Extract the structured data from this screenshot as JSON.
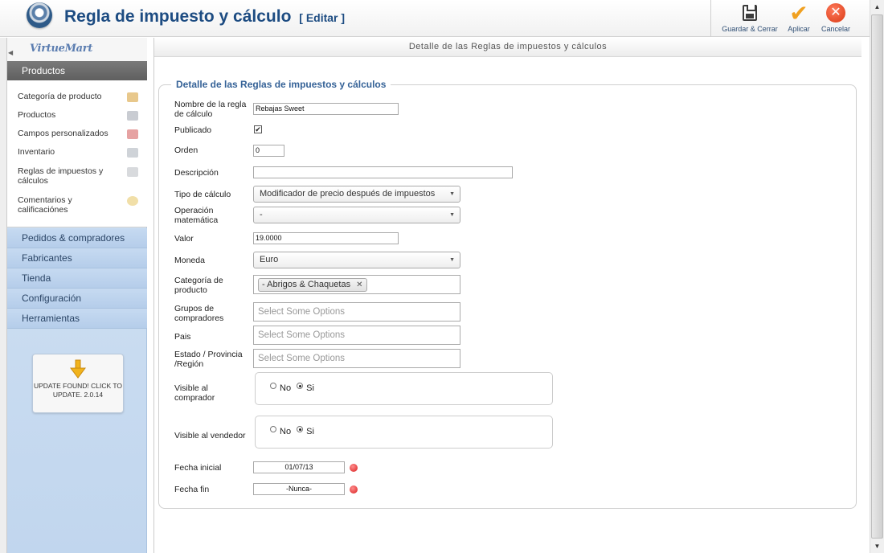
{
  "header": {
    "title": "Regla de impuesto y cálculo",
    "edit_tag": "[ Editar ]"
  },
  "toolbar": {
    "save_close": "Guardar & Cerrar",
    "apply": "Aplicar",
    "cancel": "Cancelar"
  },
  "sidebar": {
    "logo": "VirtueMart",
    "section": "Productos",
    "product_items": [
      {
        "label": "Categoría de producto",
        "icon": "category-icon"
      },
      {
        "label": "Productos",
        "icon": "products-icon"
      },
      {
        "label": "Campos personalizados",
        "icon": "custom-fields-icon"
      },
      {
        "label": "Inventario",
        "icon": "inventory-icon"
      },
      {
        "label": "Reglas de impuestos y cálculos",
        "icon": "tax-rules-icon"
      },
      {
        "label": "Comentarios y calificaciónes",
        "icon": "reviews-icon"
      }
    ],
    "nav": [
      "Pedidos & compradores",
      "Fabricantes",
      "Tienda",
      "Configuración",
      "Herramientas"
    ],
    "update_notice": "UPDATE FOUND! CLICK TO UPDATE. 2.0.14"
  },
  "main": {
    "tab_title": "Detalle de las Reglas de impuestos y cálculos",
    "legend": "Detalle de las Reglas de impuestos y cálculos",
    "fields": {
      "name_label": "Nombre de la regla de cálculo",
      "name_value": "Rebajas Sweet",
      "published_label": "Publicado",
      "published_checked": true,
      "order_label": "Orden",
      "order_value": "0",
      "description_label": "Descripción",
      "description_value": "",
      "calc_type_label": "Tipo de cálculo",
      "calc_type_value": "Modificador de precio después de impuestos",
      "math_op_label": "Operación matemática",
      "math_op_value": "-",
      "value_label": "Valor",
      "value_value": "19.0000",
      "currency_label": "Moneda",
      "currency_value": "Euro",
      "category_label": "Categoría de producto",
      "category_chip": "- Abrigos & Chaquetas",
      "groups_label": "Grupos de compradores",
      "groups_placeholder": "Select Some Options",
      "country_label": "Pais",
      "country_placeholder": "Select Some Options",
      "state_label": "Estado / Provincia /Región",
      "state_placeholder": "Select Some Options",
      "visible_shopper_label": "Visible al comprador",
      "visible_vendor_label": "Visible al vendedor",
      "radio_no": "No",
      "radio_yes": "Si",
      "start_label": "Fecha inicial",
      "start_value": "01/07/13",
      "end_label": "Fecha fin",
      "end_value": "-Nunca-"
    }
  }
}
